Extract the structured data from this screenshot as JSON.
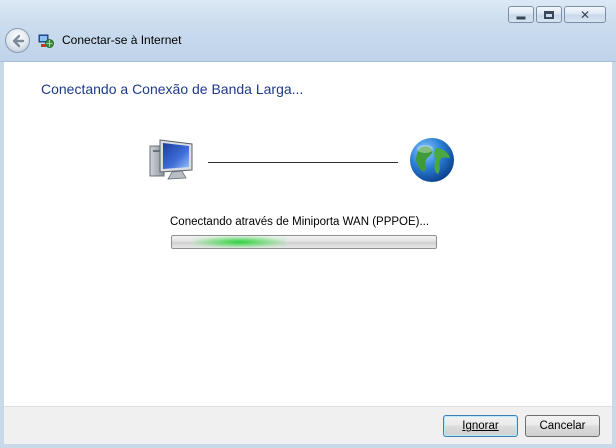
{
  "window": {
    "title": "Conectar-se à Internet",
    "icons": {
      "app": "network-connect-icon",
      "back": "back-arrow-icon"
    }
  },
  "caption_buttons": [
    "minimize",
    "maximize",
    "close"
  ],
  "content": {
    "heading": "Conectando a Conexão de Banda Larga...",
    "left_icon": "computer-icon",
    "right_icon": "globe-icon",
    "status_text": "Conectando através de Miniporta WAN (PPPOE)...",
    "progress": {
      "style": "marquee",
      "glow_color": "#26d038"
    }
  },
  "footer": {
    "ignore_label": "Ignorar",
    "cancel_label": "Cancelar"
  },
  "colors": {
    "heading": "#1e3a8a",
    "title_bar": "#c9d9ea"
  }
}
